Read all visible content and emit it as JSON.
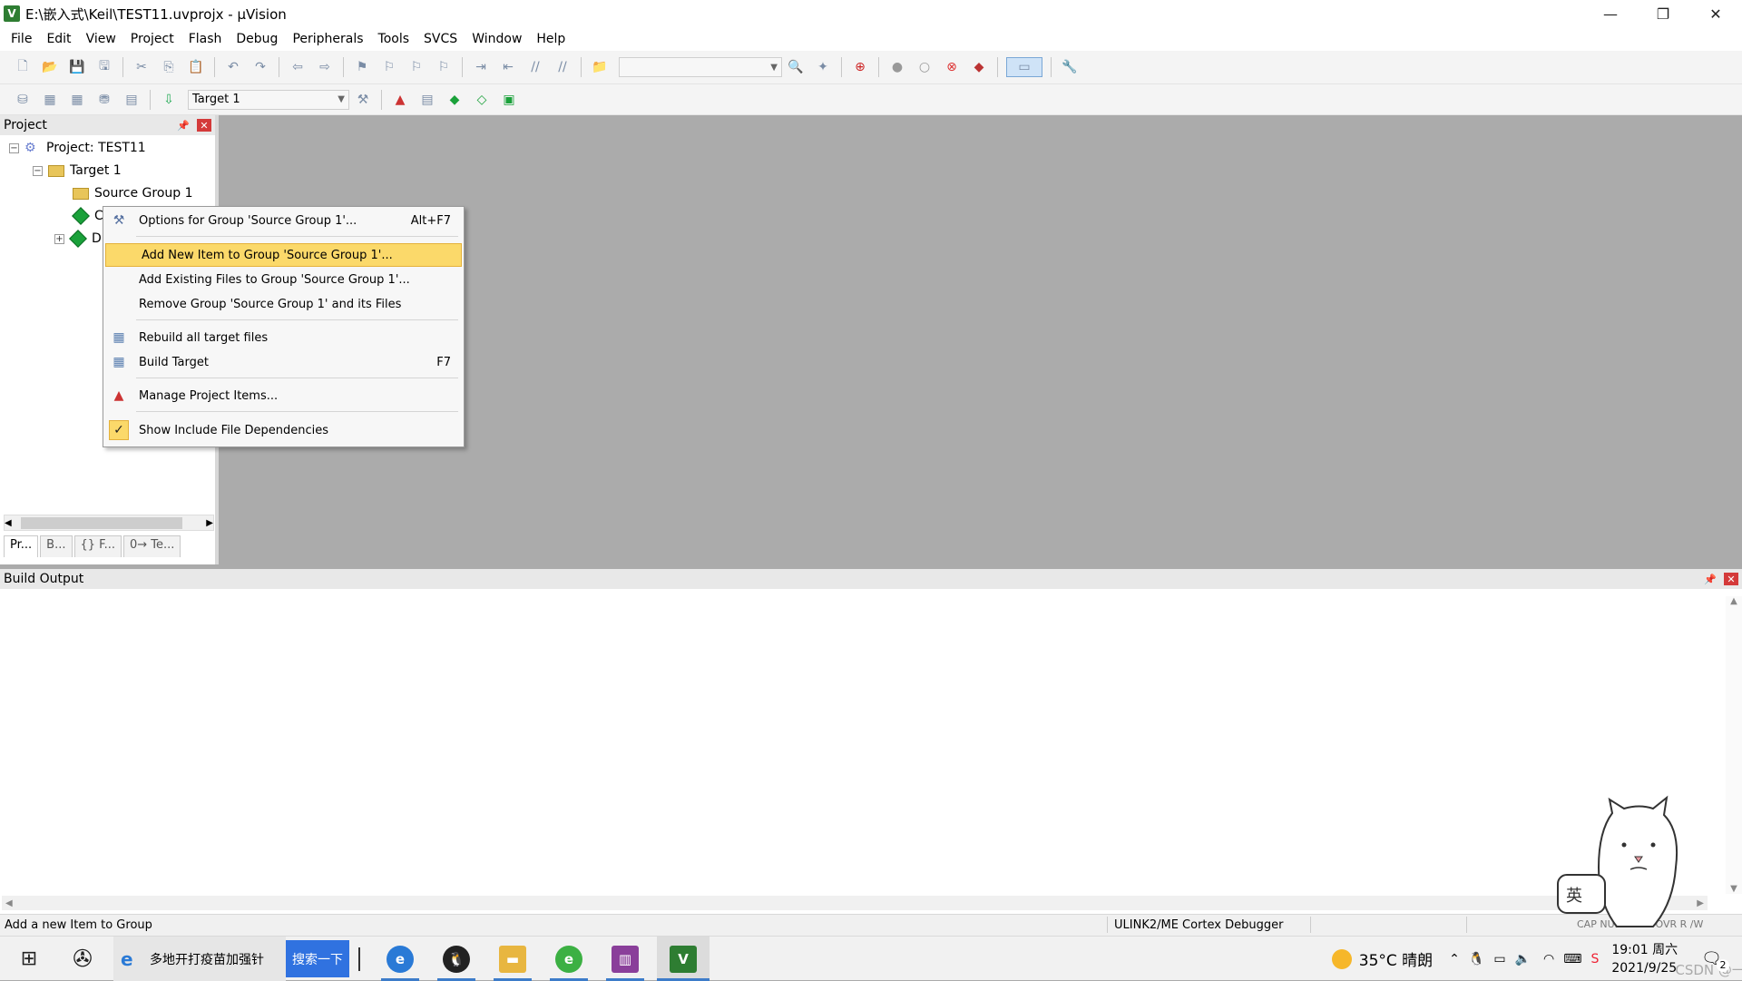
{
  "window": {
    "title": "E:\\嵌入式\\Keil\\TEST11.uvprojx - µVision",
    "app_icon": "V",
    "minimize_icon": "—",
    "restore_icon": "❐",
    "close_icon": "✕"
  },
  "menubar": [
    "File",
    "Edit",
    "View",
    "Project",
    "Flash",
    "Debug",
    "Peripherals",
    "Tools",
    "SVCS",
    "Window",
    "Help"
  ],
  "toolbar2": {
    "target_select": "Target 1"
  },
  "project_panel": {
    "title": "Project",
    "tree": {
      "root": "Project: TEST11",
      "target": "Target 1",
      "group": "Source Group 1",
      "child1": "C",
      "child2": "D"
    },
    "tabs": [
      "Pr...",
      "B...",
      "{} F...",
      "0→ Te..."
    ]
  },
  "context_menu": {
    "items": [
      {
        "label": "Options for Group 'Source Group 1'...",
        "shortcut": "Alt+F7",
        "icon": "options-wand-icon"
      },
      {
        "label": "Add New  Item to Group 'Source Group 1'...",
        "shortcut": "",
        "highlighted": true
      },
      {
        "label": "Add Existing Files to Group 'Source Group 1'...",
        "shortcut": ""
      },
      {
        "label": "Remove Group 'Source Group 1' and its Files",
        "shortcut": ""
      },
      {
        "label": "Rebuild all target files",
        "shortcut": "",
        "icon": "rebuild-icon"
      },
      {
        "label": "Build Target",
        "shortcut": "F7",
        "icon": "build-icon"
      },
      {
        "label": "Manage Project Items...",
        "shortcut": "",
        "icon": "manage-items-icon"
      },
      {
        "label": "Show Include File Dependencies",
        "shortcut": "",
        "icon": "checkmark-icon",
        "checked": true
      }
    ]
  },
  "build_output": {
    "title": "Build Output"
  },
  "statusbar": {
    "message": "Add a new Item to Group",
    "debugger": "ULINK2/ME Cortex Debugger",
    "indicators": "CAP  NUM  SCRL  OVR  R /W"
  },
  "taskbar": {
    "search_text": "多地开打疫苗加强针",
    "search_button": "搜索一下",
    "weather": "35°C  晴朗",
    "ime": "英",
    "time": "19:01 周六",
    "date": "2021/9/25",
    "notification_count": "2",
    "watermark": "CSDN @一号"
  }
}
